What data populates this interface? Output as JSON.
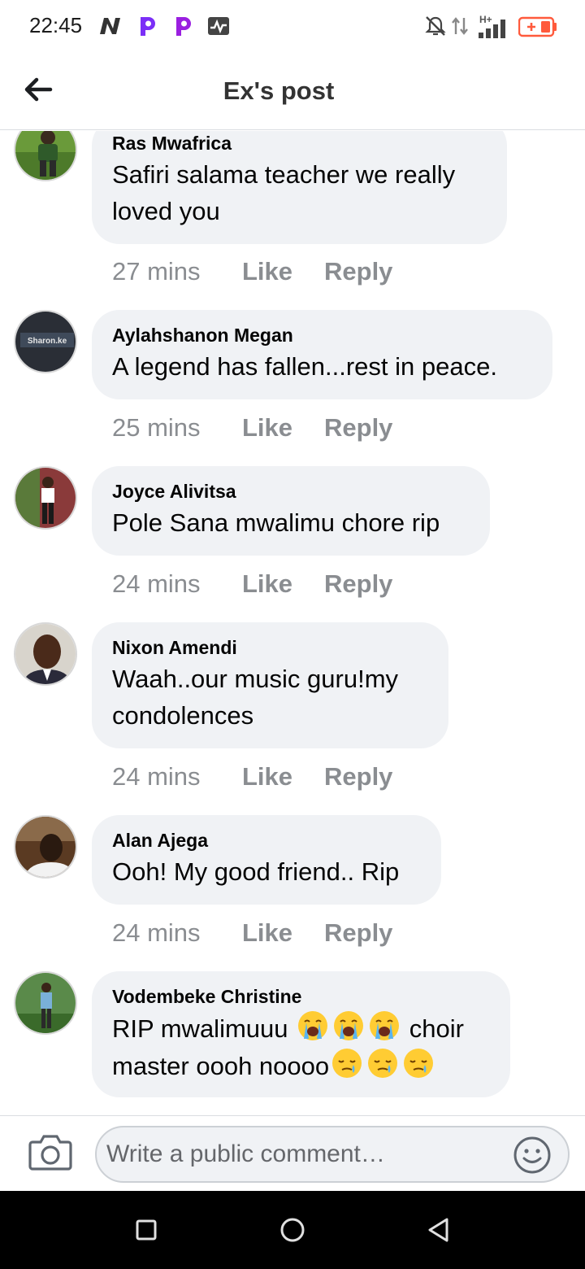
{
  "status_bar": {
    "time": "22:45",
    "network": "H+",
    "icons": [
      "n-icon",
      "p-icon",
      "p-icon",
      "activity-icon",
      "bell-off-icon",
      "data-arrows-icon",
      "signal-icon",
      "battery-icon"
    ],
    "battery_color": "#ff5a3c"
  },
  "header": {
    "title": "Ex's post",
    "back_icon": "back-arrow-icon"
  },
  "comments": [
    {
      "author": "Ras Mwafrica",
      "text": "Safiri salama teacher we really loved you",
      "time": "27 mins",
      "like": "Like",
      "reply": "Reply"
    },
    {
      "author": "Aylahshanon Megan",
      "text": "A legend has fallen...rest in peace.",
      "time": "25 mins",
      "like": "Like",
      "reply": "Reply"
    },
    {
      "author": "Joyce Alivitsa",
      "text": "Pole Sana mwalimu chore rip",
      "time": "24 mins",
      "like": "Like",
      "reply": "Reply"
    },
    {
      "author": "Nixon Amendi",
      "text": "Waah..our music guru!my condolences",
      "time": "24 mins",
      "like": "Like",
      "reply": "Reply"
    },
    {
      "author": "Alan Ajega",
      "text": "Ooh! My good friend.. Rip",
      "time": "24 mins",
      "like": "Like",
      "reply": "Reply"
    },
    {
      "author": "Vodembeke Christine",
      "text_part1": "RIP mwalimuuu",
      "text_part2": "choir",
      "text_part3": "master oooh noooo",
      "emojis_line1": [
        "loudly-crying-emoji",
        "loudly-crying-emoji",
        "loudly-crying-emoji"
      ],
      "emojis_line2": [
        "sleepy-emoji",
        "sleepy-emoji",
        "sleepy-emoji"
      ]
    }
  ],
  "avatar_labels": {
    "aylah": "Sharon.ke"
  },
  "composer": {
    "placeholder": "Write a public comment…",
    "camera_icon": "camera-icon",
    "emoji_icon": "smiley-icon"
  },
  "nav_bar": {
    "items": [
      "recents-square-icon",
      "home-circle-icon",
      "back-triangle-icon"
    ]
  },
  "colors": {
    "bubble": "#f0f2f5",
    "meta_text": "#8a8d91",
    "text": "#050505"
  }
}
